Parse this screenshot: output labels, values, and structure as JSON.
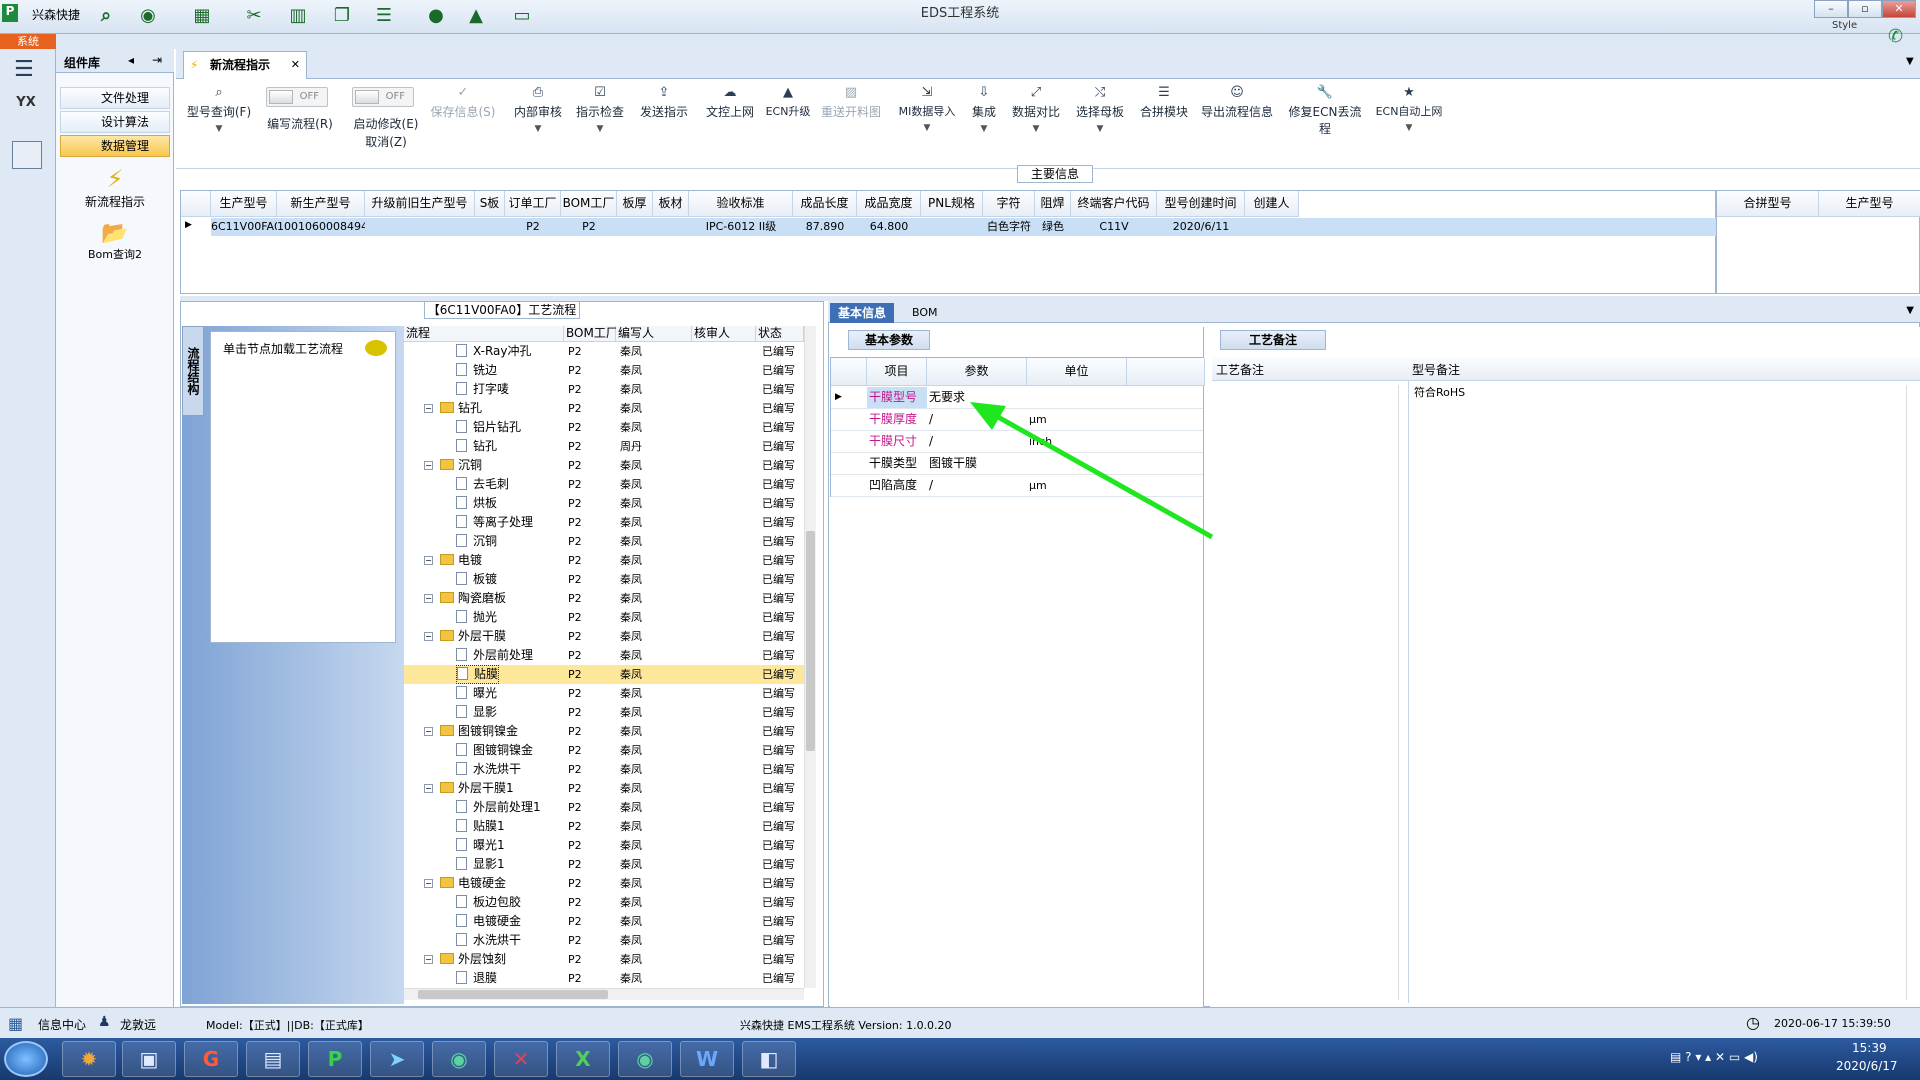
{
  "window": {
    "app_label": "兴森快捷",
    "title": "EDS工程系统",
    "style_label": "Style"
  },
  "menu": {
    "system": "系统"
  },
  "sidebar": {
    "header": "组件库",
    "items": [
      {
        "label": "文件处理"
      },
      {
        "label": "设计算法"
      },
      {
        "label": "数据管理"
      }
    ],
    "big_items": [
      {
        "label": "新流程指示"
      },
      {
        "label": "Bom查询2"
      }
    ]
  },
  "doc_tab": {
    "label": "新流程指示"
  },
  "toolbar": {
    "query": "型号查询(F)",
    "edit": "编写流程(R)",
    "start": "启动修改(E)",
    "cancel": "取消(Z)",
    "toggle_off": "OFF",
    "save": "保存信息(S)",
    "buttons": [
      "内部审核",
      "指示检查",
      "发送指示",
      "文控上网",
      "ECN升级",
      "重送开料图",
      "MI数据导入",
      "集成",
      "数据对比",
      "选择母板",
      "合拼模块",
      "导出流程信息",
      "修复ECN丢流程",
      "ECN自动上网"
    ]
  },
  "main_info": {
    "label": "主要信息",
    "columns": [
      "生产型号",
      "新生产型号",
      "升级前旧生产型号",
      "S板",
      "订单工厂",
      "BOM工厂",
      "板厚",
      "板材",
      "验收标准",
      "成品长度",
      "成品宽度",
      "PNL规格",
      "字符",
      "阻焊",
      "终端客户代码",
      "型号创建时间",
      "创建人"
    ],
    "row": [
      "6C11V00FA0",
      "10010600084943",
      "",
      "",
      "P2",
      "P2",
      "",
      "",
      "IPC-6012 II级",
      "87.890",
      "64.800",
      "",
      "白色字符",
      "绿色",
      "C11V",
      "2020/6/11",
      ""
    ]
  },
  "merge_grid": {
    "columns": [
      "合拼型号",
      "生产型号"
    ]
  },
  "process": {
    "label": "【6C11V00FA0】工艺流程",
    "vertical_tab": "流程结构",
    "hint": "单击节点加载工艺流程",
    "columns": [
      "流程",
      "BOM工厂",
      "编写人",
      "核审人",
      "状态"
    ],
    "rows": [
      {
        "name": "X-Ray冲孔",
        "level": 2,
        "folder": false,
        "bom": "P2",
        "writer": "秦凤",
        "status": "已编写"
      },
      {
        "name": "铣边",
        "level": 2,
        "folder": false,
        "bom": "P2",
        "writer": "秦凤",
        "status": "已编写"
      },
      {
        "name": "打字唛",
        "level": 2,
        "folder": false,
        "bom": "P2",
        "writer": "秦凤",
        "status": "已编写"
      },
      {
        "name": "钻孔",
        "level": 1,
        "folder": true,
        "bom": "P2",
        "writer": "秦凤",
        "status": "已编写"
      },
      {
        "name": "铝片钻孔",
        "level": 2,
        "folder": false,
        "bom": "P2",
        "writer": "秦凤",
        "status": "已编写"
      },
      {
        "name": "钻孔",
        "level": 2,
        "folder": false,
        "bom": "P2",
        "writer": "周丹",
        "status": "已编写"
      },
      {
        "name": "沉铜",
        "level": 1,
        "folder": true,
        "bom": "P2",
        "writer": "秦凤",
        "status": "已编写"
      },
      {
        "name": "去毛刺",
        "level": 2,
        "folder": false,
        "bom": "P2",
        "writer": "秦凤",
        "status": "已编写"
      },
      {
        "name": "烘板",
        "level": 2,
        "folder": false,
        "bom": "P2",
        "writer": "秦凤",
        "status": "已编写"
      },
      {
        "name": "等离子处理",
        "level": 2,
        "folder": false,
        "bom": "P2",
        "writer": "秦凤",
        "status": "已编写"
      },
      {
        "name": "沉铜",
        "level": 2,
        "folder": false,
        "bom": "P2",
        "writer": "秦凤",
        "status": "已编写"
      },
      {
        "name": "电镀",
        "level": 1,
        "folder": true,
        "bom": "P2",
        "writer": "秦凤",
        "status": "已编写"
      },
      {
        "name": "板镀",
        "level": 2,
        "folder": false,
        "bom": "P2",
        "writer": "秦凤",
        "status": "已编写"
      },
      {
        "name": "陶瓷磨板",
        "level": 1,
        "folder": true,
        "bom": "P2",
        "writer": "秦凤",
        "status": "已编写"
      },
      {
        "name": "抛光",
        "level": 2,
        "folder": false,
        "bom": "P2",
        "writer": "秦凤",
        "status": "已编写"
      },
      {
        "name": "外层干膜",
        "level": 1,
        "folder": true,
        "bom": "P2",
        "writer": "秦凤",
        "status": "已编写"
      },
      {
        "name": "外层前处理",
        "level": 2,
        "folder": false,
        "bom": "P2",
        "writer": "秦凤",
        "status": "已编写"
      },
      {
        "name": "贴膜",
        "level": 2,
        "folder": false,
        "bom": "P2",
        "writer": "秦凤",
        "status": "已编写",
        "selected": true
      },
      {
        "name": "曝光",
        "level": 2,
        "folder": false,
        "bom": "P2",
        "writer": "秦凤",
        "status": "已编写"
      },
      {
        "name": "显影",
        "level": 2,
        "folder": false,
        "bom": "P2",
        "writer": "秦凤",
        "status": "已编写"
      },
      {
        "name": "图镀铜镍金",
        "level": 1,
        "folder": true,
        "bom": "P2",
        "writer": "秦凤",
        "status": "已编写"
      },
      {
        "name": "图镀铜镍金",
        "level": 2,
        "folder": false,
        "bom": "P2",
        "writer": "秦凤",
        "status": "已编写"
      },
      {
        "name": "水洗烘干",
        "level": 2,
        "folder": false,
        "bom": "P2",
        "writer": "秦凤",
        "status": "已编写"
      },
      {
        "name": "外层干膜1",
        "level": 1,
        "folder": true,
        "bom": "P2",
        "writer": "秦凤",
        "status": "已编写"
      },
      {
        "name": "外层前处理1",
        "level": 2,
        "folder": false,
        "bom": "P2",
        "writer": "秦凤",
        "status": "已编写"
      },
      {
        "name": "贴膜1",
        "level": 2,
        "folder": false,
        "bom": "P2",
        "writer": "秦凤",
        "status": "已编写"
      },
      {
        "name": "曝光1",
        "level": 2,
        "folder": false,
        "bom": "P2",
        "writer": "秦凤",
        "status": "已编写"
      },
      {
        "name": "显影1",
        "level": 2,
        "folder": false,
        "bom": "P2",
        "writer": "秦凤",
        "status": "已编写"
      },
      {
        "name": "电镀硬金",
        "level": 1,
        "folder": true,
        "bom": "P2",
        "writer": "秦凤",
        "status": "已编写"
      },
      {
        "name": "板边包胶",
        "level": 2,
        "folder": false,
        "bom": "P2",
        "writer": "秦凤",
        "status": "已编写"
      },
      {
        "name": "电镀硬金",
        "level": 2,
        "folder": false,
        "bom": "P2",
        "writer": "秦凤",
        "status": "已编写"
      },
      {
        "name": "水洗烘干",
        "level": 2,
        "folder": false,
        "bom": "P2",
        "writer": "秦凤",
        "status": "已编写"
      },
      {
        "name": "外层蚀刻",
        "level": 1,
        "folder": true,
        "bom": "P2",
        "writer": "秦凤",
        "status": "已编写"
      },
      {
        "name": "退膜",
        "level": 2,
        "folder": false,
        "bom": "P2",
        "writer": "秦凤",
        "status": "已编写"
      }
    ]
  },
  "right": {
    "tabs": [
      "基本信息",
      "BOM"
    ],
    "param_tab": "基本参数",
    "param_columns": [
      "项目",
      "参数",
      "单位"
    ],
    "params": [
      {
        "item": "干膜型号",
        "value": "无要求",
        "unit": "",
        "accent": true
      },
      {
        "item": "干膜厚度",
        "value": "/",
        "unit": "μm",
        "accent": true
      },
      {
        "item": "干膜尺寸",
        "value": "/",
        "unit": "inch",
        "accent": true
      },
      {
        "item": "干膜类型",
        "value": "图镀干膜",
        "unit": "",
        "accent": false
      },
      {
        "item": "凹陷高度",
        "value": "/",
        "unit": "μm",
        "accent": false
      }
    ],
    "notes_tab": "工艺备注",
    "notes_columns": [
      "工艺备注",
      "型号备注"
    ],
    "model_note": "符合RoHS"
  },
  "status": {
    "info_center": "信息中心",
    "user": "龙敦远",
    "model": "Model:【正式】||DB:【正式库】",
    "version": "兴森快捷 EMS工程系统 Version: 1.0.0.20",
    "datetime": "2020-06-17 15:39:50"
  },
  "taskbar": {
    "time": "15:39",
    "date": "2020/6/17"
  },
  "colors": {
    "accent_item": "#c0178a",
    "selection": "#c9dff5",
    "tree_selection": "#fde79a",
    "arrow": "#1fe61f"
  }
}
